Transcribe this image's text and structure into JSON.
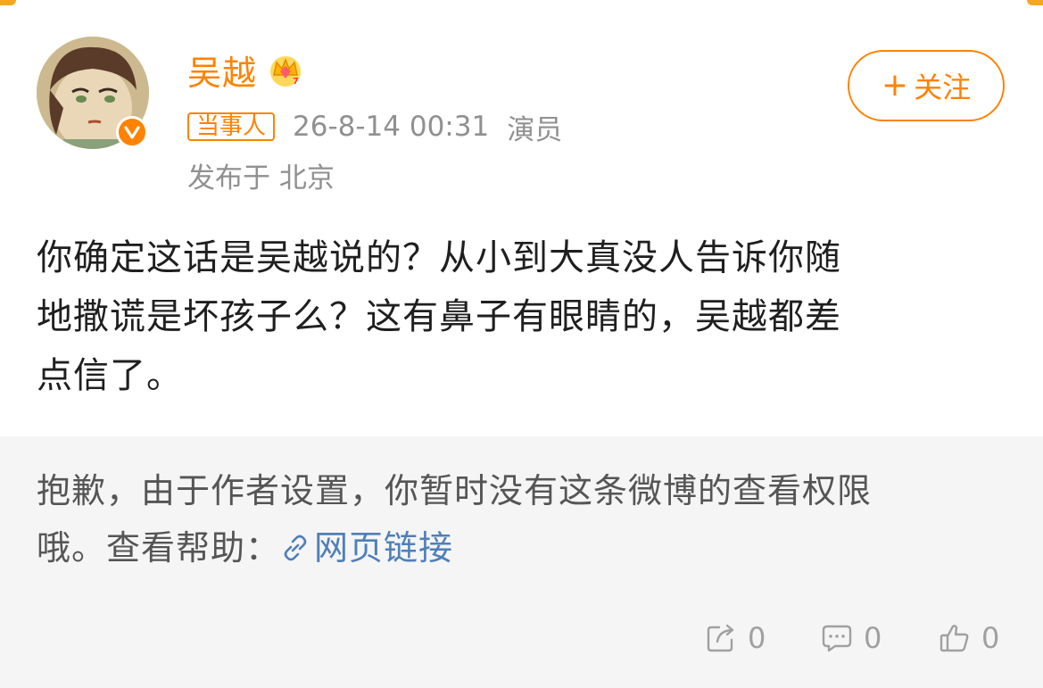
{
  "post": {
    "author": {
      "name": "吴越",
      "tag": "当事人",
      "role": "演员",
      "verified_icon": "verified-v-icon",
      "member_icon": "crown-icon"
    },
    "timestamp": "26-8-14 00:31",
    "location": "发布于 北京",
    "follow_button": {
      "plus": "+",
      "label": "关注"
    },
    "body_lines": [
      "你确定这话是吴越说的？从小到大真没人告诉你随",
      "地撒谎是坏孩子么？这有鼻子有眼睛的，吴越都差",
      "点信了。"
    ]
  },
  "notice": {
    "line1": "抱歉，由于作者设置，你暂时没有这条微博的查看权限",
    "line2_prefix": "哦。查看帮助：",
    "link_label": "网页链接",
    "link_icon": "link-icon"
  },
  "actions": {
    "repost": {
      "icon": "repost-icon",
      "count": "0"
    },
    "comment": {
      "icon": "comment-icon",
      "count": "0"
    },
    "like": {
      "icon": "thumbs-up-icon",
      "count": "0"
    }
  },
  "colors": {
    "accent": "#ff8200",
    "link": "#4f7fb8",
    "notice_bg": "#f5f5f5",
    "muted": "#909090"
  }
}
